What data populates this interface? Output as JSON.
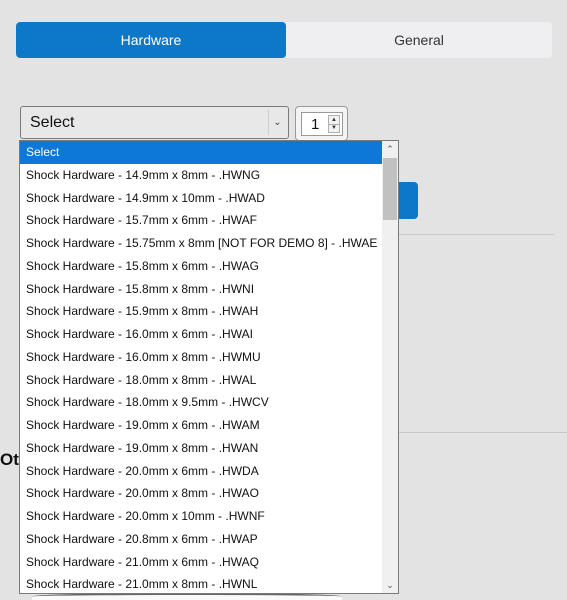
{
  "tabs": [
    {
      "label": "Hardware",
      "active": true
    },
    {
      "label": "General",
      "active": false
    }
  ],
  "select": {
    "value": "Select",
    "arrow_icon": "chevron-down-icon"
  },
  "quantity": {
    "value": "1"
  },
  "dropdown": {
    "options": [
      "Select",
      "Shock Hardware - 14.9mm x 8mm - .HWNG",
      "Shock Hardware - 14.9mm x 10mm - .HWAD",
      "Shock Hardware - 15.7mm x 6mm - .HWAF",
      "Shock Hardware - 15.75mm x 8mm [NOT FOR DEMO 8] - .HWAE",
      "Shock Hardware - 15.8mm x 6mm - .HWAG",
      "Shock Hardware - 15.8mm x 8mm - .HWNI",
      "Shock Hardware - 15.9mm x 8mm - .HWAH",
      "Shock Hardware - 16.0mm x 6mm - .HWAI",
      "Shock Hardware - 16.0mm x 8mm - .HWMU",
      "Shock Hardware - 18.0mm x 8mm - .HWAL",
      "Shock Hardware - 18.0mm x 9.5mm - .HWCV",
      "Shock Hardware - 19.0mm x 6mm - .HWAM",
      "Shock Hardware - 19.0mm x 8mm - .HWAN",
      "Shock Hardware - 20.0mm x 6mm - .HWDA",
      "Shock Hardware - 20.0mm x 8mm - .HWAO",
      "Shock Hardware - 20.0mm x 10mm - .HWNF",
      "Shock Hardware - 20.8mm x 6mm - .HWAP",
      "Shock Hardware - 21.0mm x 6mm - .HWAQ",
      "Shock Hardware - 21.0mm x 8mm - .HWNL"
    ],
    "selected_index": 0
  },
  "background": {
    "partial_heading": "Ot"
  },
  "colors": {
    "accent": "#0d78c8",
    "selected": "#0d78d7"
  }
}
